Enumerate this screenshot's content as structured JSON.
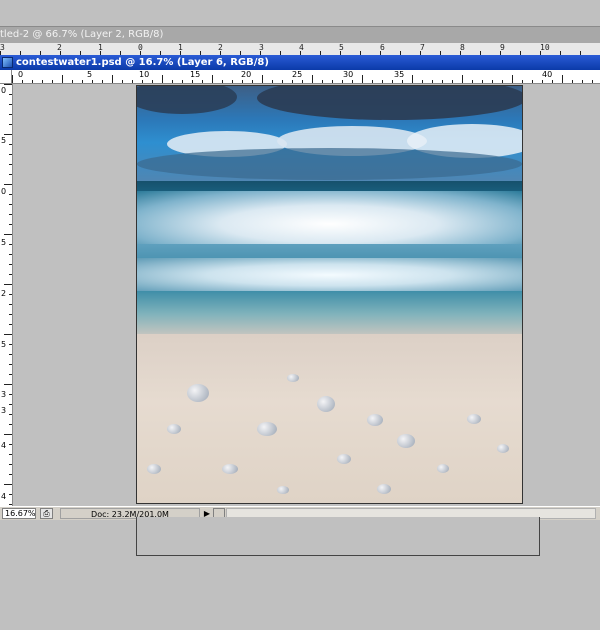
{
  "background_document": {
    "title": "tled-2 @ 66.7% (Layer 2, RGB/8)",
    "ruler_numbers": [
      "3",
      "2",
      "1",
      "0",
      "1",
      "2",
      "3",
      "4",
      "5",
      "6",
      "7",
      "8",
      "9",
      "10"
    ]
  },
  "document": {
    "title": "contestwater1.psd @ 16.7% (Layer 6, RGB/8)",
    "ruler_numbers": [
      "0",
      "5",
      "10",
      "15",
      "20",
      "25",
      "30",
      "35",
      "40"
    ],
    "left_ruler_numbers": [
      "0",
      "5",
      "0",
      "5",
      "2",
      "5",
      "3",
      "3",
      "4",
      "4"
    ]
  },
  "statusbar": {
    "zoom": "16.67%",
    "doc_info": "Doc: 23.2M/201.0M",
    "arrow": "▶"
  },
  "colors": {
    "titlebar_active": "#0b3aa8",
    "titlebar_inactive": "#a8a8a8",
    "workspace": "#c0c0c0"
  }
}
